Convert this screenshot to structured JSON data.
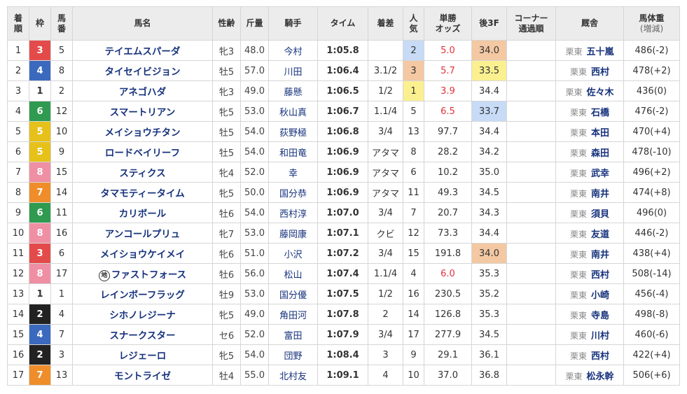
{
  "headers": {
    "finish": [
      "着",
      "順"
    ],
    "frame": "枠",
    "num": [
      "馬",
      "番"
    ],
    "horse": "馬名",
    "sexage": "性齢",
    "weight": "斤量",
    "jockey": "騎手",
    "time": "タイム",
    "margin": "着差",
    "pop": [
      "人",
      "気"
    ],
    "odds": [
      "単勝",
      "オッズ"
    ],
    "last3f": "後3F",
    "corner": [
      "コーナー",
      "通過順"
    ],
    "trainer": "厩舎",
    "bodyweight": [
      "馬体重",
      "(増減)"
    ]
  },
  "rows": [
    {
      "finish": "1",
      "frame": "3",
      "num": "5",
      "horse": "テイエムスパーダ",
      "mark": "",
      "sexage": "牝3",
      "weight": "48.0",
      "jockey": "今村",
      "time": "1:05.8",
      "margin": "",
      "pop": "2",
      "odds": "5.0",
      "last3f": "34.0",
      "corner": "",
      "region": "栗東",
      "trainer": "五十嵐",
      "bodyweight": "486(-2)"
    },
    {
      "finish": "2",
      "frame": "4",
      "num": "8",
      "horse": "タイセイビジョン",
      "mark": "",
      "sexage": "牡5",
      "weight": "57.0",
      "jockey": "川田",
      "time": "1:06.4",
      "margin": "3.1/2",
      "pop": "3",
      "odds": "5.7",
      "last3f": "33.5",
      "corner": "",
      "region": "栗東",
      "trainer": "西村",
      "bodyweight": "478(+2)"
    },
    {
      "finish": "3",
      "frame": "1",
      "num": "2",
      "horse": "アネゴハダ",
      "mark": "",
      "sexage": "牝3",
      "weight": "49.0",
      "jockey": "藤懸",
      "time": "1:06.5",
      "margin": "1/2",
      "pop": "1",
      "odds": "3.9",
      "last3f": "34.4",
      "corner": "",
      "region": "栗東",
      "trainer": "佐々木",
      "bodyweight": "436(0)"
    },
    {
      "finish": "4",
      "frame": "6",
      "num": "12",
      "horse": "スマートリアン",
      "mark": "",
      "sexage": "牝5",
      "weight": "53.0",
      "jockey": "秋山真",
      "time": "1:06.7",
      "margin": "1.1/4",
      "pop": "5",
      "odds": "6.5",
      "last3f": "33.7",
      "corner": "",
      "region": "栗東",
      "trainer": "石橋",
      "bodyweight": "476(-2)"
    },
    {
      "finish": "5",
      "frame": "5",
      "num": "10",
      "horse": "メイショウチタン",
      "mark": "",
      "sexage": "牡5",
      "weight": "54.0",
      "jockey": "荻野極",
      "time": "1:06.8",
      "margin": "3/4",
      "pop": "13",
      "odds": "97.7",
      "last3f": "34.4",
      "corner": "",
      "region": "栗東",
      "trainer": "本田",
      "bodyweight": "470(+4)"
    },
    {
      "finish": "6",
      "frame": "5",
      "num": "9",
      "horse": "ロードベイリーフ",
      "mark": "",
      "sexage": "牡5",
      "weight": "54.0",
      "jockey": "和田竜",
      "time": "1:06.9",
      "margin": "アタマ",
      "pop": "8",
      "odds": "28.2",
      "last3f": "34.2",
      "corner": "",
      "region": "栗東",
      "trainer": "森田",
      "bodyweight": "478(-10)"
    },
    {
      "finish": "7",
      "frame": "8",
      "num": "15",
      "horse": "スティクス",
      "mark": "",
      "sexage": "牝4",
      "weight": "52.0",
      "jockey": "幸",
      "time": "1:06.9",
      "margin": "アタマ",
      "pop": "6",
      "odds": "10.2",
      "last3f": "35.0",
      "corner": "",
      "region": "栗東",
      "trainer": "武幸",
      "bodyweight": "496(+2)"
    },
    {
      "finish": "8",
      "frame": "7",
      "num": "14",
      "horse": "タマモティータイム",
      "mark": "",
      "sexage": "牝5",
      "weight": "50.0",
      "jockey": "国分恭",
      "time": "1:06.9",
      "margin": "アタマ",
      "pop": "11",
      "odds": "49.3",
      "last3f": "34.5",
      "corner": "",
      "region": "栗東",
      "trainer": "南井",
      "bodyweight": "474(+8)"
    },
    {
      "finish": "9",
      "frame": "6",
      "num": "11",
      "horse": "カリボール",
      "mark": "",
      "sexage": "牡6",
      "weight": "54.0",
      "jockey": "西村淳",
      "time": "1:07.0",
      "margin": "3/4",
      "pop": "7",
      "odds": "20.7",
      "last3f": "34.3",
      "corner": "",
      "region": "栗東",
      "trainer": "須貝",
      "bodyweight": "496(0)"
    },
    {
      "finish": "10",
      "frame": "8",
      "num": "16",
      "horse": "アンコールプリュ",
      "mark": "",
      "sexage": "牝7",
      "weight": "53.0",
      "jockey": "藤岡康",
      "time": "1:07.1",
      "margin": "クビ",
      "pop": "12",
      "odds": "73.3",
      "last3f": "34.4",
      "corner": "",
      "region": "栗東",
      "trainer": "友道",
      "bodyweight": "446(-2)"
    },
    {
      "finish": "11",
      "frame": "3",
      "num": "6",
      "horse": "メイショウケイメイ",
      "mark": "",
      "sexage": "牝6",
      "weight": "51.0",
      "jockey": "小沢",
      "time": "1:07.2",
      "margin": "3/4",
      "pop": "15",
      "odds": "191.8",
      "last3f": "34.0",
      "corner": "",
      "region": "栗東",
      "trainer": "南井",
      "bodyweight": "438(+4)"
    },
    {
      "finish": "12",
      "frame": "8",
      "num": "17",
      "horse": "ファストフォース",
      "mark": "地",
      "sexage": "牡6",
      "weight": "56.0",
      "jockey": "松山",
      "time": "1:07.4",
      "margin": "1.1/4",
      "pop": "4",
      "odds": "6.0",
      "last3f": "35.3",
      "corner": "",
      "region": "栗東",
      "trainer": "西村",
      "bodyweight": "508(-14)"
    },
    {
      "finish": "13",
      "frame": "1",
      "num": "1",
      "horse": "レインボーフラッグ",
      "mark": "",
      "sexage": "牡9",
      "weight": "53.0",
      "jockey": "国分優",
      "time": "1:07.5",
      "margin": "1/2",
      "pop": "16",
      "odds": "230.5",
      "last3f": "35.2",
      "corner": "",
      "region": "栗東",
      "trainer": "小崎",
      "bodyweight": "456(-4)"
    },
    {
      "finish": "14",
      "frame": "2",
      "num": "4",
      "horse": "シホノレジーナ",
      "mark": "",
      "sexage": "牝5",
      "weight": "49.0",
      "jockey": "角田河",
      "time": "1:07.8",
      "margin": "2",
      "pop": "14",
      "odds": "126.8",
      "last3f": "35.3",
      "corner": "",
      "region": "栗東",
      "trainer": "寺島",
      "bodyweight": "498(-8)"
    },
    {
      "finish": "15",
      "frame": "4",
      "num": "7",
      "horse": "スナークスター",
      "mark": "",
      "sexage": "セ6",
      "weight": "52.0",
      "jockey": "富田",
      "time": "1:07.9",
      "margin": "3/4",
      "pop": "17",
      "odds": "277.9",
      "last3f": "34.5",
      "corner": "",
      "region": "栗東",
      "trainer": "川村",
      "bodyweight": "460(-6)"
    },
    {
      "finish": "16",
      "frame": "2",
      "num": "3",
      "horse": "レジェーロ",
      "mark": "",
      "sexage": "牝5",
      "weight": "54.0",
      "jockey": "団野",
      "time": "1:08.4",
      "margin": "3",
      "pop": "9",
      "odds": "29.1",
      "last3f": "36.1",
      "corner": "",
      "region": "栗東",
      "trainer": "西村",
      "bodyweight": "422(+4)"
    },
    {
      "finish": "17",
      "frame": "7",
      "num": "13",
      "horse": "モントライゼ",
      "mark": "",
      "sexage": "牡4",
      "weight": "55.0",
      "jockey": "北村友",
      "time": "1:09.1",
      "margin": "4",
      "pop": "10",
      "odds": "37.0",
      "last3f": "36.8",
      "corner": "",
      "region": "栗東",
      "trainer": "松永幹",
      "bodyweight": "506(+6)"
    }
  ],
  "highlights": {
    "pop": {
      "1": "pop1",
      "2": "pop2",
      "3": "pop3"
    },
    "hot_odds_max_pop": 5,
    "last3f": {
      "33.5": "l1",
      "33.7": "l2",
      "34.0": "l3"
    }
  },
  "colors": {
    "frame1": "#ffffff",
    "frame2": "#222222",
    "frame3": "#e34b4b",
    "frame4": "#3a69be",
    "frame5": "#e6c11a",
    "frame6": "#2f9a50",
    "frame7": "#ef8d2b",
    "frame8": "#ef8fa4",
    "link": "#16327c",
    "hot_odds": "#e0323b"
  }
}
